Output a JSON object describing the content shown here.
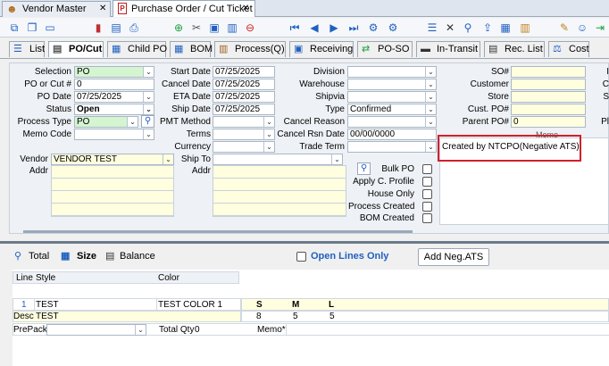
{
  "doc_tabs": [
    {
      "label": "Vendor Master",
      "close": "✕"
    },
    {
      "label": "Purchase Order / Cut Ticket",
      "close": "✕"
    }
  ],
  "colors": {
    "accent": "#2060c0",
    "highlight_box": "#d0202a",
    "field_yellow": "#ffffe0",
    "field_green": "#d4f5d0"
  },
  "view_tabs": [
    "List",
    "PO/Cut",
    "Child PO",
    "BOM",
    "Process(Q)",
    "Receiving",
    "PO-SO",
    "In-Transit",
    "Rec. List",
    "Cost"
  ],
  "col1": {
    "labels": [
      "Selection",
      "PO or Cut #",
      "PO Date",
      "Status",
      "Process Type",
      "Memo Code"
    ],
    "values": [
      "PO",
      "0",
      "07/25/2025",
      "Open",
      "PO",
      ""
    ]
  },
  "col2": {
    "labels": [
      "Start Date",
      "Cancel Date",
      "ETA Date",
      "Ship Date",
      "PMT Method",
      "Terms",
      "Currency",
      "Ship To",
      "Addr"
    ],
    "values": [
      "07/25/2025",
      "07/25/2025",
      "07/25/2025",
      "07/25/2025",
      "",
      "",
      "",
      ""
    ]
  },
  "col3": {
    "labels": [
      "Division",
      "Warehouse",
      "Shipvia",
      "Type",
      "Cancel Reason",
      "Cancel Rsn Date",
      "Trade Term"
    ],
    "values": [
      "",
      "",
      "",
      "Confirmed",
      "",
      "00/00/0000",
      ""
    ]
  },
  "col4": {
    "labels": [
      "SO#",
      "Customer",
      "Store",
      "Cust. PO#",
      "Parent PO#"
    ],
    "values": [
      "",
      "",
      "",
      "",
      "0"
    ]
  },
  "col5": {
    "labels": [
      "I",
      "C",
      "S",
      "",
      "Pl"
    ]
  },
  "vendor": {
    "label": "Vendor",
    "value": "VENDOR TEST",
    "addr_label": "Addr"
  },
  "checks": [
    "Bulk PO",
    "Apply C. Profile",
    "House Only",
    "Process Created",
    "BOM Created"
  ],
  "memo": {
    "label": "Memo",
    "text": "Created by NTCPO(Negative ATS)"
  },
  "bottom_tabs": [
    "Total",
    "Size",
    "Balance"
  ],
  "open_lines": "Open Lines Only",
  "add_neg": "Add Neg.ATS",
  "grid": {
    "header": [
      "Line",
      "Style",
      "Color"
    ],
    "sizes": [
      "S",
      "M",
      "L"
    ],
    "line": "1",
    "style": "TEST",
    "color": "TEST COLOR 1",
    "qty": [
      "8",
      "5",
      "5"
    ],
    "desc_label": "Desc",
    "desc": "TEST",
    "prepack_label": "PrePack",
    "total_label": "Total Qty",
    "total": "0",
    "memo_label": "Memo*"
  }
}
